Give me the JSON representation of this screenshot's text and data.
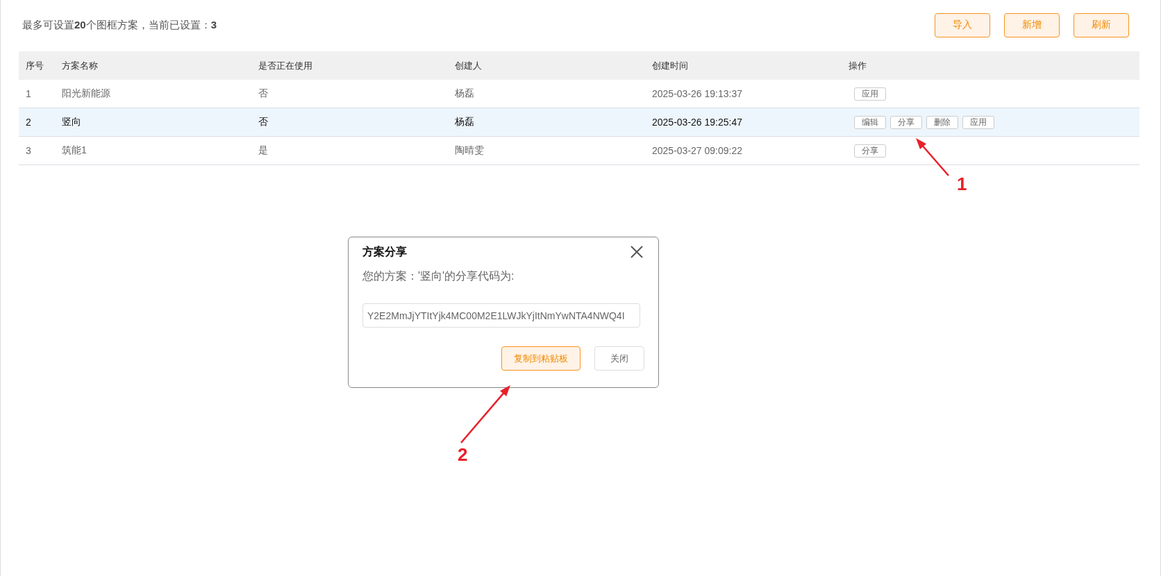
{
  "summary": "最多可设置**20**个图框方案，当前已设置：**3**",
  "toolbar": [
    "导入",
    "新增",
    "刷新"
  ],
  "table": {
    "columns": [
      "序号",
      "方案名称",
      "是否正在使用",
      "创建人",
      "创建时间",
      "操作"
    ],
    "rows": [
      {
        "cells": [
          "1",
          "阳光新能源",
          "否",
          "杨磊",
          "2025-03-26 19:13:37"
        ],
        "actions": [
          "应用"
        ],
        "selected": false
      },
      {
        "cells": [
          "2",
          "竖向",
          "否",
          "杨磊",
          "2025-03-26 19:25:47"
        ],
        "actions": [
          "编辑",
          "分享",
          "删除",
          "应用"
        ],
        "selected": true
      },
      {
        "cells": [
          "3",
          "筑能1",
          "是",
          "陶晴雯",
          "2025-03-27 09:09:22"
        ],
        "actions": [
          "分享"
        ],
        "selected": false
      }
    ]
  },
  "dialog": {
    "title": "方案分享",
    "message": "您的方案：'竖向'的分享代码为:",
    "code": "Y2E2MmJjYTItYjk4MC00M2E1LWJkYjItNmYwNTA4NWQ4I",
    "buttons": [
      {
        "label": "复制到粘贴板",
        "kind": "primary"
      },
      {
        "label": "关闭",
        "kind": "default"
      }
    ]
  },
  "annotations": [
    {
      "label": "1"
    },
    {
      "label": "2"
    }
  ]
}
